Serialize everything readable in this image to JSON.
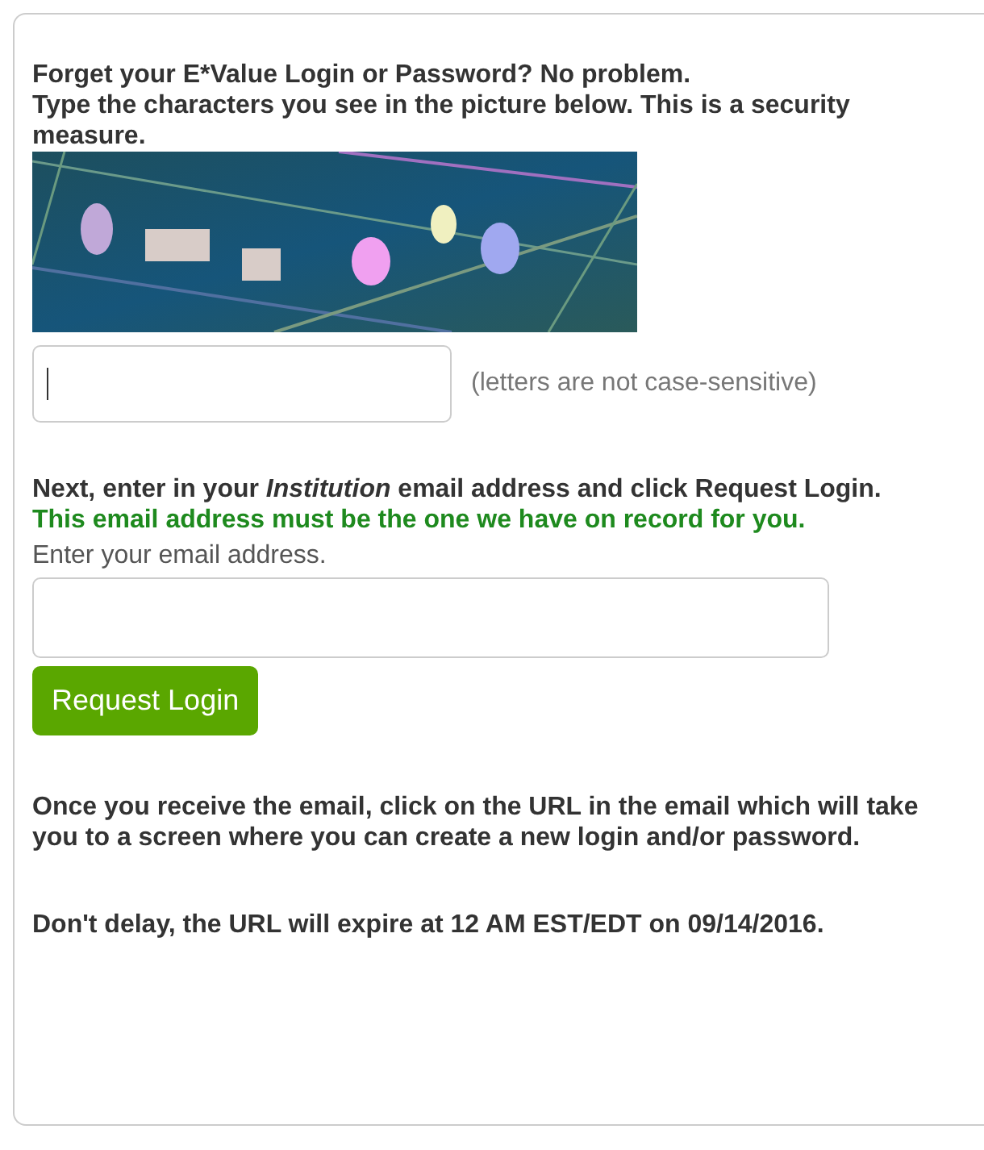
{
  "intro": [
    "Forget your E*Value Login or Password? No problem.",
    "Type the characters you see in the picture below. This is a security measure."
  ],
  "captcha": {
    "input": {
      "focused": true
    },
    "hint": "(letters are not case-sensitive)"
  },
  "instruction": "Next, enter in your *Institution* email address and click Request Login.",
  "notice": "This email address must be the one we have on record for you.",
  "email_label": "Enter your email address.",
  "email_input": {
    "focused": false
  },
  "button": "Request Login",
  "paragraphs": [
    "Once you receive the email, click on the URL in the email which will take you to a screen where you can create a new login and/or password.",
    "Don't delay, the URL will expire at 12 AM EST/EDT on 09/14/2016."
  ]
}
